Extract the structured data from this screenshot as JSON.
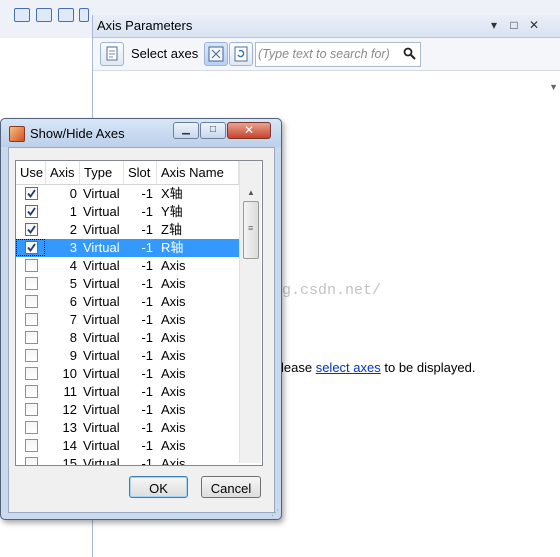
{
  "panel": {
    "title": "Axis Parameters",
    "toolbar_label": "Select axes",
    "search_placeholder": "(Type text to search for)",
    "message_prefix": "lease",
    "message_link": "select axes",
    "message_suffix": "to be displayed."
  },
  "dialog": {
    "title": "Show/Hide Axes",
    "columns": [
      "Use",
      "Axis",
      "Type",
      "Slot",
      "Axis Name"
    ],
    "rows": [
      {
        "use": true,
        "axis": "0",
        "type": "Virtual",
        "slot": "-1",
        "name": "X轴"
      },
      {
        "use": true,
        "axis": "1",
        "type": "Virtual",
        "slot": "-1",
        "name": "Y轴"
      },
      {
        "use": true,
        "axis": "2",
        "type": "Virtual",
        "slot": "-1",
        "name": "Z轴"
      },
      {
        "use": true,
        "axis": "3",
        "type": "Virtual",
        "slot": "-1",
        "name": "R轴",
        "selected": true
      },
      {
        "use": false,
        "axis": "4",
        "type": "Virtual",
        "slot": "-1",
        "name": "Axis"
      },
      {
        "use": false,
        "axis": "5",
        "type": "Virtual",
        "slot": "-1",
        "name": "Axis"
      },
      {
        "use": false,
        "axis": "6",
        "type": "Virtual",
        "slot": "-1",
        "name": "Axis"
      },
      {
        "use": false,
        "axis": "7",
        "type": "Virtual",
        "slot": "-1",
        "name": "Axis"
      },
      {
        "use": false,
        "axis": "8",
        "type": "Virtual",
        "slot": "-1",
        "name": "Axis"
      },
      {
        "use": false,
        "axis": "9",
        "type": "Virtual",
        "slot": "-1",
        "name": "Axis"
      },
      {
        "use": false,
        "axis": "10",
        "type": "Virtual",
        "slot": "-1",
        "name": "Axis"
      },
      {
        "use": false,
        "axis": "11",
        "type": "Virtual",
        "slot": "-1",
        "name": "Axis"
      },
      {
        "use": false,
        "axis": "12",
        "type": "Virtual",
        "slot": "-1",
        "name": "Axis"
      },
      {
        "use": false,
        "axis": "13",
        "type": "Virtual",
        "slot": "-1",
        "name": "Axis"
      },
      {
        "use": false,
        "axis": "14",
        "type": "Virtual",
        "slot": "-1",
        "name": "Axis"
      },
      {
        "use": false,
        "axis": "15",
        "type": "Virtual",
        "slot": "-1",
        "name": "Axis"
      }
    ],
    "ok_label": "OK",
    "cancel_label": "Cancel"
  },
  "watermark": "http://blog.csdn.net/",
  "icons": {
    "toolbar_page": "page-icon",
    "toolbar_select": "select-axes-icon",
    "toolbar_refresh": "refresh-icon",
    "search": "search-icon",
    "dialog": "dialog-app-icon"
  },
  "colors": {
    "selection": "#3399ff",
    "link": "#0033cc",
    "dialog_frame": "#c9d9ee"
  }
}
